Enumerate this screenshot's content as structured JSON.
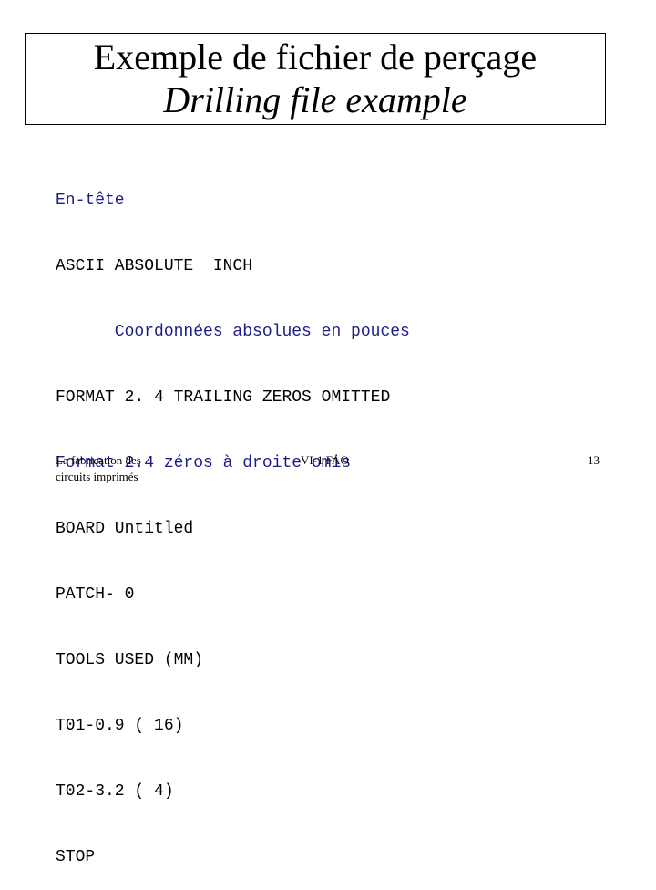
{
  "slide": {
    "title_fr": "Exemple de fichier de perçage",
    "title_en": "Drilling file example",
    "lines": [
      {
        "text": "En-tête",
        "color": "#1c1c86"
      },
      {
        "text": "ASCII ABSOLUTE  INCH",
        "color": "#000000"
      },
      {
        "text": "      Coordonnées absolues en pouces",
        "color": "#1c1c86"
      },
      {
        "text": "FORMAT 2. 4 TRAILING ZEROS OMITTED",
        "color": "#000000"
      },
      {
        "text": "Format 2.4 zéros à droite omis",
        "color": "#1c1c86"
      },
      {
        "text": "BOARD Untitled",
        "color": "#000000"
      },
      {
        "text": "PATCH- 0",
        "color": "#000000"
      },
      {
        "text": "TOOLS USED (MM)",
        "color": "#000000"
      },
      {
        "text": "T01-0.9 ( 16)",
        "color": "#000000"
      },
      {
        "text": "T02-3.2 ( 4)",
        "color": "#000000"
      },
      {
        "text": "STOP",
        "color": "#000000"
      }
    ]
  },
  "footer": {
    "left_line1": "La fabrication des",
    "left_line2": "circuits imprimés",
    "center": "VI-1 FAO",
    "page_number": "13"
  }
}
